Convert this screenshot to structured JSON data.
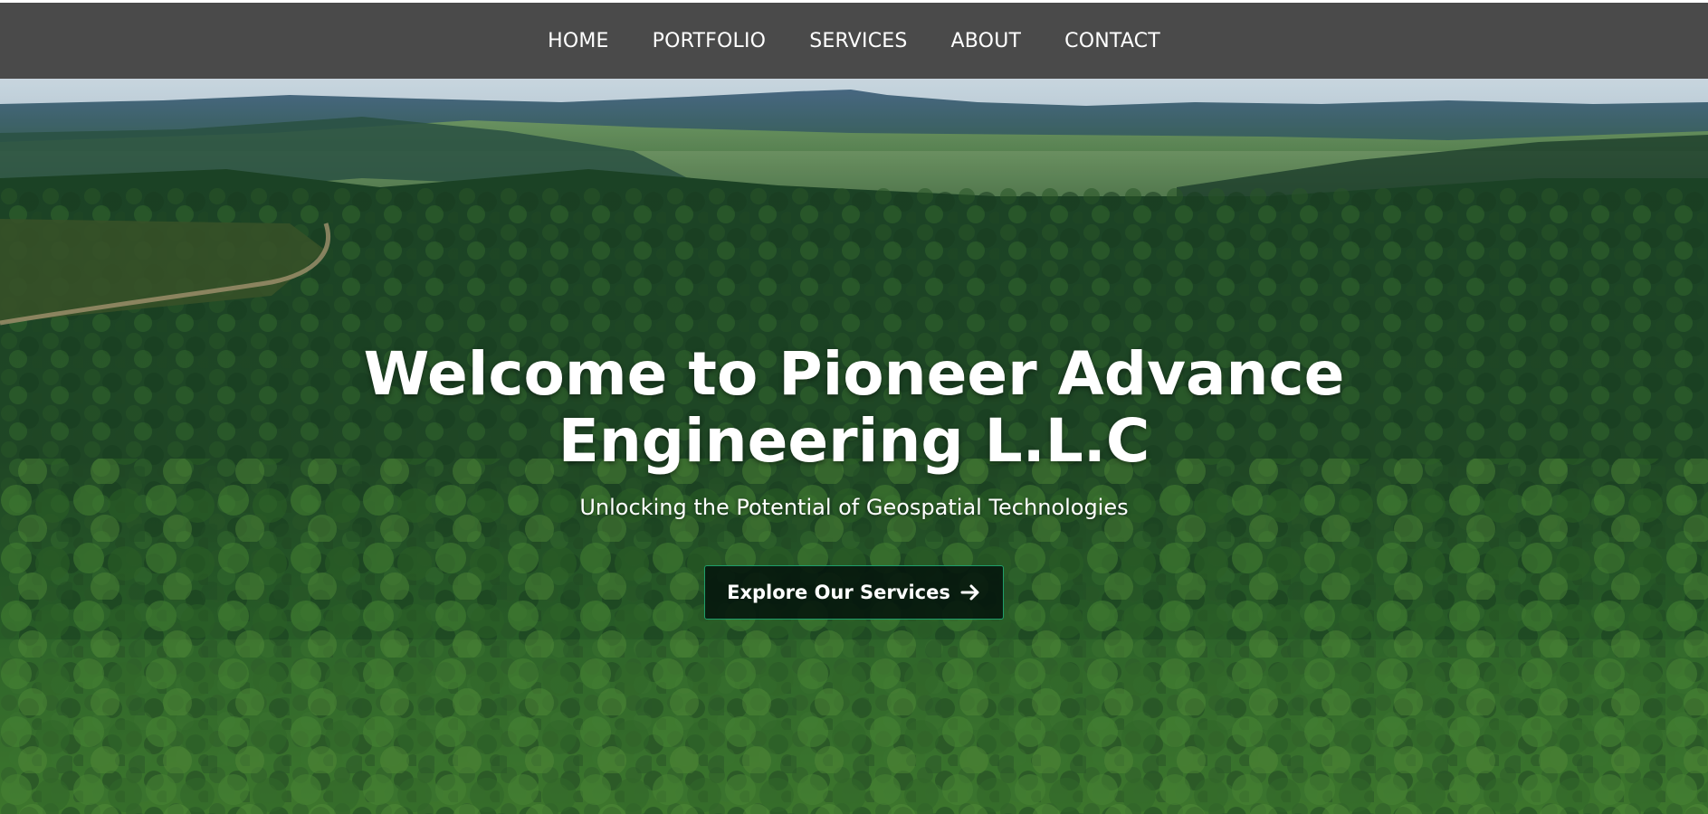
{
  "nav": {
    "items": [
      {
        "label": "HOME"
      },
      {
        "label": "PORTFOLIO"
      },
      {
        "label": "SERVICES"
      },
      {
        "label": "ABOUT"
      },
      {
        "label": "CONTACT"
      }
    ]
  },
  "hero": {
    "title_line1": "Welcome to Pioneer Advance",
    "title_line2": "Engineering L.L.C",
    "subtitle": "Unlocking the Potential of Geospatial Technologies",
    "cta_label": "Explore Our Services",
    "cta_icon": "arrow-right-icon"
  },
  "colors": {
    "navbar_bg": "#4a4a4a",
    "nav_text": "#ffffff",
    "cta_border": "#1f9e6a",
    "cta_bg": "#04140c"
  }
}
